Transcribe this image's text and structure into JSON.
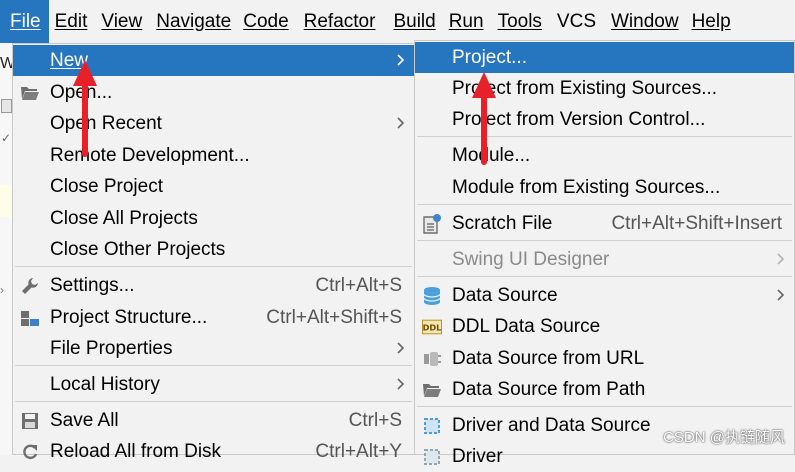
{
  "menubar": {
    "items": [
      {
        "label": "File",
        "active": true
      },
      {
        "label": "Edit"
      },
      {
        "label": "View"
      },
      {
        "label": "Navigate"
      },
      {
        "label": "Code"
      },
      {
        "label": "Refactor"
      },
      {
        "label": "Build"
      },
      {
        "label": "Run"
      },
      {
        "label": "Tools"
      },
      {
        "label": "VCS"
      },
      {
        "label": "Window"
      },
      {
        "label": "Help"
      }
    ]
  },
  "edge": {
    "partial_letter": "W"
  },
  "file_menu": {
    "items": [
      {
        "label": "New",
        "submenu": true,
        "selected": true
      },
      {
        "label": "Open...",
        "icon": "folder-open-icon"
      },
      {
        "label": "Open Recent",
        "submenu": true
      },
      {
        "label": "Remote Development..."
      },
      {
        "label": "Close Project"
      },
      {
        "label": "Close All Projects"
      },
      {
        "label": "Close Other Projects"
      },
      {
        "label": "Settings...",
        "icon": "wrench-icon",
        "shortcut": "Ctrl+Alt+S"
      },
      {
        "label": "Project Structure...",
        "icon": "project-structure-icon",
        "shortcut": "Ctrl+Alt+Shift+S"
      },
      {
        "label": "File Properties",
        "submenu": true
      },
      {
        "label": "Local History",
        "submenu": true
      },
      {
        "label": "Save All",
        "icon": "save-icon",
        "shortcut": "Ctrl+S"
      },
      {
        "label": "Reload All from Disk",
        "icon": "reload-icon",
        "shortcut": "Ctrl+Alt+Y"
      }
    ]
  },
  "new_menu": {
    "items": [
      {
        "label": "Project...",
        "selected": true
      },
      {
        "label": "Project from Existing Sources..."
      },
      {
        "label": "Project from Version Control..."
      },
      {
        "label": "Module..."
      },
      {
        "label": "Module from Existing Sources..."
      },
      {
        "label": "Scratch File",
        "icon": "scratch-file-icon",
        "shortcut": "Ctrl+Alt+Shift+Insert"
      },
      {
        "label": "Swing UI Designer",
        "submenu": true,
        "disabled": true
      },
      {
        "label": "Data Source",
        "icon": "database-icon",
        "submenu": true
      },
      {
        "label": "DDL Data Source",
        "icon": "ddl-icon"
      },
      {
        "label": "Data Source from URL",
        "icon": "url-plug-icon"
      },
      {
        "label": "Data Source from Path",
        "icon": "folder-icon"
      },
      {
        "label": "Driver and Data Source",
        "icon": "driver-datasource-icon"
      },
      {
        "label": "Driver",
        "icon": "driver-icon"
      }
    ]
  },
  "colors": {
    "accent": "#2675bf",
    "menu_bg": "#f2f2f2",
    "arrow": "#e8202a"
  },
  "watermark": "CSDN @执链随风"
}
